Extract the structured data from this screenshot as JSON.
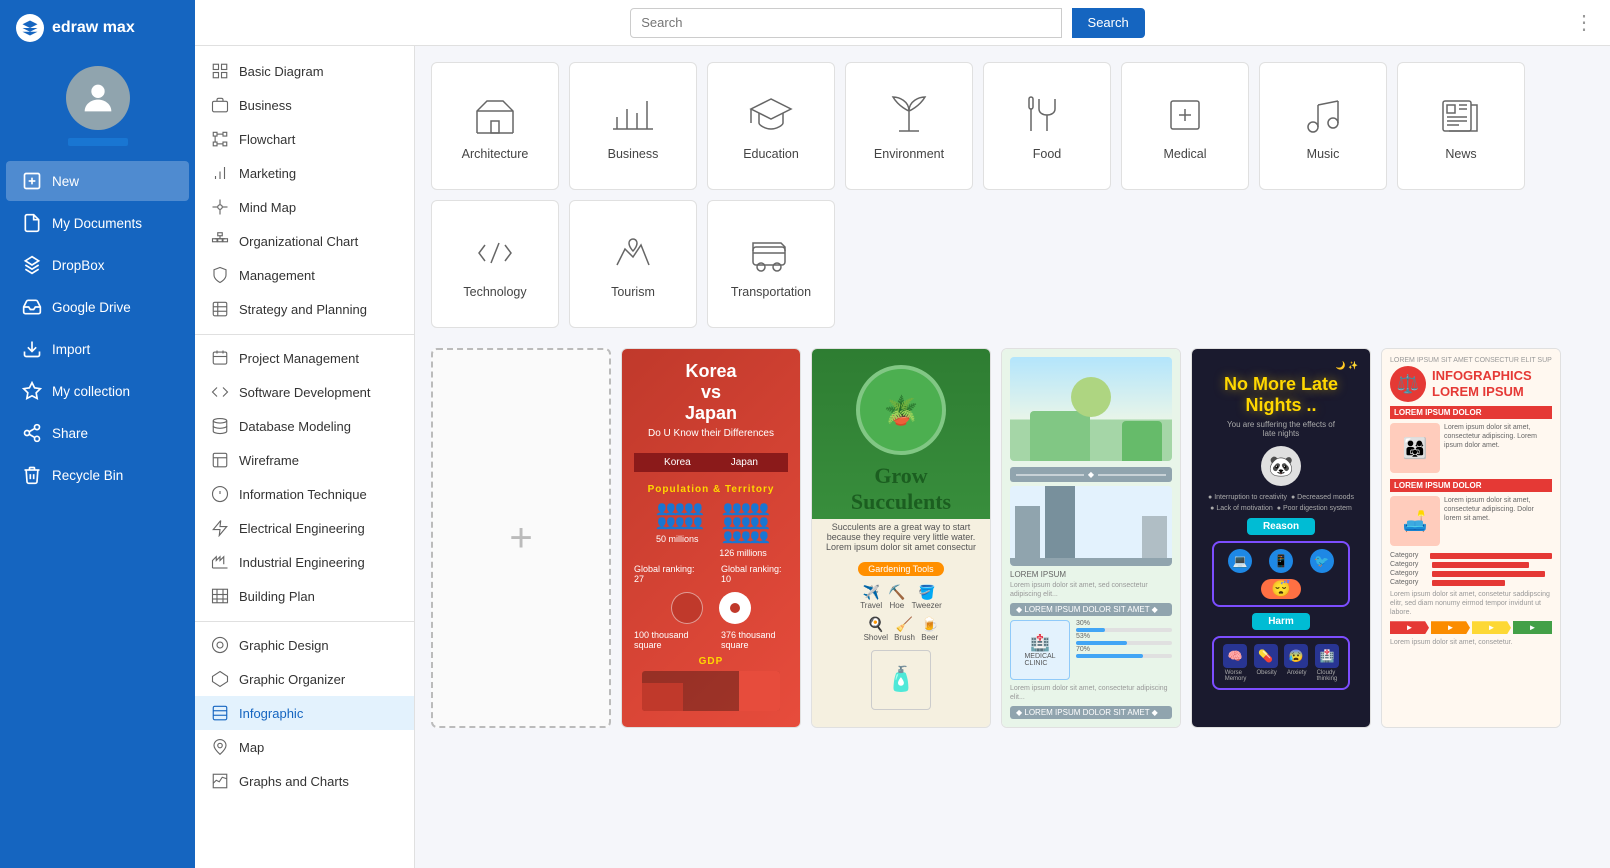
{
  "app": {
    "name": "edraw max",
    "logo_text": "edraw max"
  },
  "topbar": {
    "search_placeholder": "Search",
    "search_button_label": "Search"
  },
  "sidebar_nav": [
    {
      "id": "new",
      "label": "New",
      "icon": "plus-square"
    },
    {
      "id": "my-documents",
      "label": "My Documents",
      "icon": "file"
    },
    {
      "id": "dropbox",
      "label": "DropBox",
      "icon": "dropbox"
    },
    {
      "id": "google-drive",
      "label": "Google Drive",
      "icon": "cloud"
    },
    {
      "id": "import",
      "label": "Import",
      "icon": "import"
    },
    {
      "id": "my-collection",
      "label": "My collection",
      "icon": "star"
    },
    {
      "id": "share",
      "label": "Share",
      "icon": "share"
    },
    {
      "id": "recycle-bin",
      "label": "Recycle Bin",
      "icon": "trash"
    }
  ],
  "left_menu": {
    "sections": [
      {
        "items": [
          {
            "id": "basic-diagram",
            "label": "Basic Diagram"
          },
          {
            "id": "business",
            "label": "Business"
          },
          {
            "id": "flowchart",
            "label": "Flowchart"
          },
          {
            "id": "marketing",
            "label": "Marketing"
          },
          {
            "id": "mind-map",
            "label": "Mind Map"
          },
          {
            "id": "organizational-chart",
            "label": "Organizational Chart"
          },
          {
            "id": "management",
            "label": "Management"
          },
          {
            "id": "strategy-and-planning",
            "label": "Strategy and Planning"
          }
        ]
      },
      {
        "items": [
          {
            "id": "project-management",
            "label": "Project Management"
          },
          {
            "id": "software-development",
            "label": "Software Development"
          },
          {
            "id": "database-modeling",
            "label": "Database Modeling"
          },
          {
            "id": "wireframe",
            "label": "Wireframe"
          },
          {
            "id": "information-technique",
            "label": "Information Technique"
          },
          {
            "id": "electrical-engineering",
            "label": "Electrical Engineering"
          },
          {
            "id": "industrial-engineering",
            "label": "Industrial Engineering"
          },
          {
            "id": "building-plan",
            "label": "Building Plan"
          }
        ]
      },
      {
        "items": [
          {
            "id": "graphic-design",
            "label": "Graphic Design"
          },
          {
            "id": "graphic-organizer",
            "label": "Graphic Organizer"
          },
          {
            "id": "infographic",
            "label": "Infographic",
            "active": true
          },
          {
            "id": "map",
            "label": "Map"
          },
          {
            "id": "graphs-and-charts",
            "label": "Graphs and Charts"
          }
        ]
      }
    ]
  },
  "categories": [
    {
      "id": "architecture",
      "label": "Architecture",
      "icon": "building"
    },
    {
      "id": "business",
      "label": "Business",
      "icon": "chart-bar"
    },
    {
      "id": "education",
      "label": "Education",
      "icon": "graduation"
    },
    {
      "id": "environment",
      "label": "Environment",
      "icon": "leaf"
    },
    {
      "id": "food",
      "label": "Food",
      "icon": "food"
    },
    {
      "id": "medical",
      "label": "Medical",
      "icon": "medical-cross"
    },
    {
      "id": "music",
      "label": "Music",
      "icon": "music"
    },
    {
      "id": "news",
      "label": "News",
      "icon": "news"
    },
    {
      "id": "technology",
      "label": "Technology",
      "icon": "technology"
    },
    {
      "id": "tourism",
      "label": "Tourism",
      "icon": "tourism"
    },
    {
      "id": "transportation",
      "label": "Transportation",
      "icon": "transportation"
    }
  ],
  "templates": [
    {
      "id": "new",
      "type": "new",
      "label": "+"
    },
    {
      "id": "korea-japan",
      "type": "korea-japan",
      "label": "Korea vs Japan"
    },
    {
      "id": "succulents",
      "type": "succulents",
      "label": "Grow Succulents"
    },
    {
      "id": "landscape",
      "type": "landscape",
      "label": "Landscape"
    },
    {
      "id": "late-nights",
      "type": "late-nights",
      "label": "No More Late Nights _ Reason"
    },
    {
      "id": "infographics-lorem",
      "type": "infographics-lorem",
      "label": "INFOGRAPHICS LOREM IPSUM"
    }
  ]
}
